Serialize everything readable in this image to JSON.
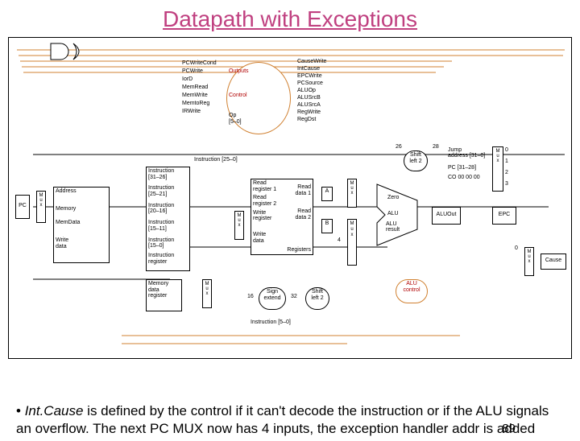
{
  "title": "Datapath with Exceptions",
  "control_signals_left": {
    "l0": "PCWriteCond",
    "l1": "PCWrite",
    "l2": "IorD",
    "l3": "MemRead",
    "l4": "MemWrite",
    "l5": "MemtoReg",
    "l6": "IRWrite"
  },
  "control_signals_right": {
    "r0": "CauseWrite",
    "r1": "IntCause",
    "r2": "EPCWrite",
    "r3": "PCSource",
    "r4": "ALUOp",
    "r5": "ALUSrcB",
    "r6": "ALUSrcA",
    "r7": "RegWrite",
    "r8": "RegDst"
  },
  "control": {
    "outputs": "Outputs",
    "label": "Control",
    "op": "Op\n[5–0]"
  },
  "pc": "PC",
  "memory": {
    "addr": "Address",
    "name": "Memory",
    "md": "MemData",
    "wd": "Write\ndata"
  },
  "ir": {
    "top": "Instruction [25–0]",
    "f0": "Instruction\n[31–26]",
    "f1": "Instruction\n[25–21]",
    "f2": "Instruction\n[20–16]",
    "f3": "Instruction\n[15–11]",
    "f4": "Instruction\n[15–0]",
    "reg": "Instruction\nregister"
  },
  "mdr": "Memory\ndata\nregister",
  "regfile": {
    "rr1": "Read\nregister 1",
    "rr2": "Read\nregister 2",
    "wr": "Write\nregister",
    "rd1": "Read\ndata 1",
    "rd2": "Read\ndata 2",
    "wd": "Write\ndata",
    "name": "Registers"
  },
  "se": "Sign\nextend",
  "sl2a": "Shift\nleft 2",
  "sl2b": "Shift\nleft 2",
  "alu": {
    "name": "ALU",
    "zero": "Zero",
    "res": "ALU\nresult"
  },
  "aluout": "ALUOut",
  "epc": "EPC",
  "cause": "Cause",
  "aluctl": "ALU\ncontrol",
  "mux": {
    "m": "M\nu\nx",
    "m01": [
      "0",
      "1"
    ],
    "m0123": [
      "0",
      "1",
      "2",
      "3"
    ]
  },
  "consts": {
    "w26": "26",
    "w28": "28",
    "w16": "16",
    "w32": "32",
    "four": "4",
    "zero": "0",
    "jaddr": "Jump\naddress [31–0]",
    "pc3128": "PC [31–28]",
    "coaddr": "CO 00 00 00"
  },
  "inst50": "Instruction [5–0]",
  "areg": "A",
  "breg": "B",
  "bullet": {
    "pre": "Int.Cause",
    "text": " is defined by the control if it can't decode the instruction or if the ALU signals an overflow. The next PC MUX now has 4 inputs, the exception handler addr is added",
    "pg": "89"
  }
}
